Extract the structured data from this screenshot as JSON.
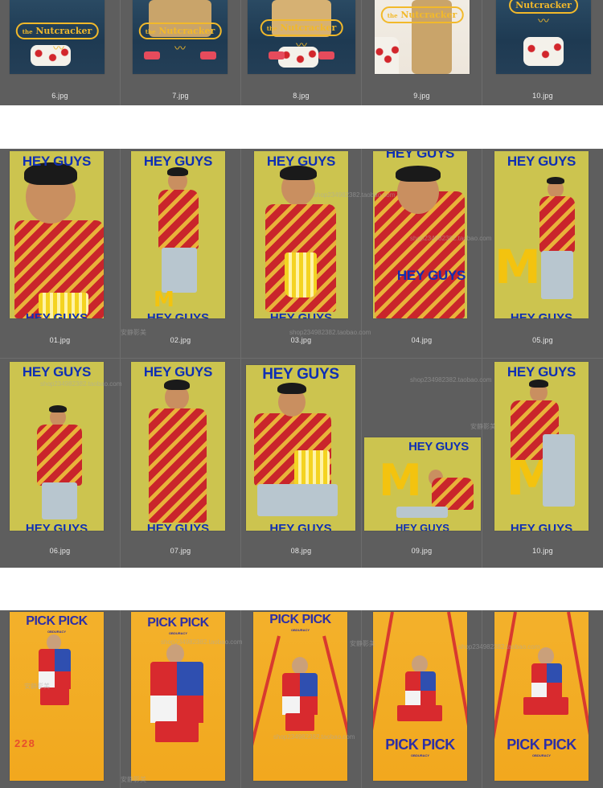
{
  "rows": [
    {
      "id": "nutcracker",
      "items": [
        {
          "filename": "6.jpg",
          "title_small": "the",
          "title": "Nutcracker"
        },
        {
          "filename": "7.jpg",
          "title_small": "the",
          "title": "Nutcracker"
        },
        {
          "filename": "8.jpg",
          "title_small": "the",
          "title": "Nutcracker"
        },
        {
          "filename": "9.jpg",
          "title_small": "the",
          "title": "Nutcracker"
        },
        {
          "filename": "10.jpg",
          "title_small": "",
          "title": "Nutcracker"
        }
      ]
    },
    {
      "id": "hey-guys-1",
      "items": [
        {
          "filename": "01.jpg",
          "title": "HEY GUYS",
          "bottom": "HEY GUYS"
        },
        {
          "filename": "02.jpg",
          "title": "HEY GUYS",
          "bottom": "HEY GUYS"
        },
        {
          "filename": "03.jpg",
          "title": "HEY GUYS",
          "bottom": "HEY GUYS"
        },
        {
          "filename": "04.jpg",
          "title": "HEY GUYS",
          "bottom": "HEY GUYS"
        },
        {
          "filename": "05.jpg",
          "title": "HEY GUYS",
          "bottom": "HEY GUYS"
        }
      ]
    },
    {
      "id": "hey-guys-2",
      "items": [
        {
          "filename": "06.jpg",
          "title": "HEY GUYS",
          "bottom": "HEY GUYS"
        },
        {
          "filename": "07.jpg",
          "title": "HEY GUYS",
          "bottom": "HEY GUYS"
        },
        {
          "filename": "08.jpg",
          "title": "HEY GUYS",
          "bottom": "HEY GUYS"
        },
        {
          "filename": "09.jpg",
          "title": "HEY GUYS",
          "bottom": "HEY GUYS"
        },
        {
          "filename": "10.jpg",
          "title": "HEY GUYS",
          "bottom": "HEY GUYS"
        }
      ]
    },
    {
      "id": "pick-pick",
      "items": [
        {
          "title": "PICK PICK",
          "sub": "OBDURACY",
          "cones": "2 2 8"
        },
        {
          "title": "PICK PICK",
          "sub": "OBDURACY"
        },
        {
          "title": "PICK PICK",
          "sub": "OBDURACY"
        },
        {
          "title": "PICK PICK",
          "sub": "OBDURACY"
        },
        {
          "title": "PICK PICK",
          "sub": "OBDURACY"
        }
      ]
    }
  ],
  "watermarks": {
    "shop": "shop234982382.taobao.com",
    "shop_alt": "shop234982382.taobao.com",
    "cn": "安静影美"
  },
  "colors": {
    "panel": "#5e5e5e",
    "hey_bg": "#ccc44f",
    "hey_title": "#0f2fb3",
    "pick_bg": "#f3b12b",
    "pick_title": "#2d2fa6",
    "nut_bg": "#1e3a52",
    "nut_gold": "#f2b92a"
  }
}
